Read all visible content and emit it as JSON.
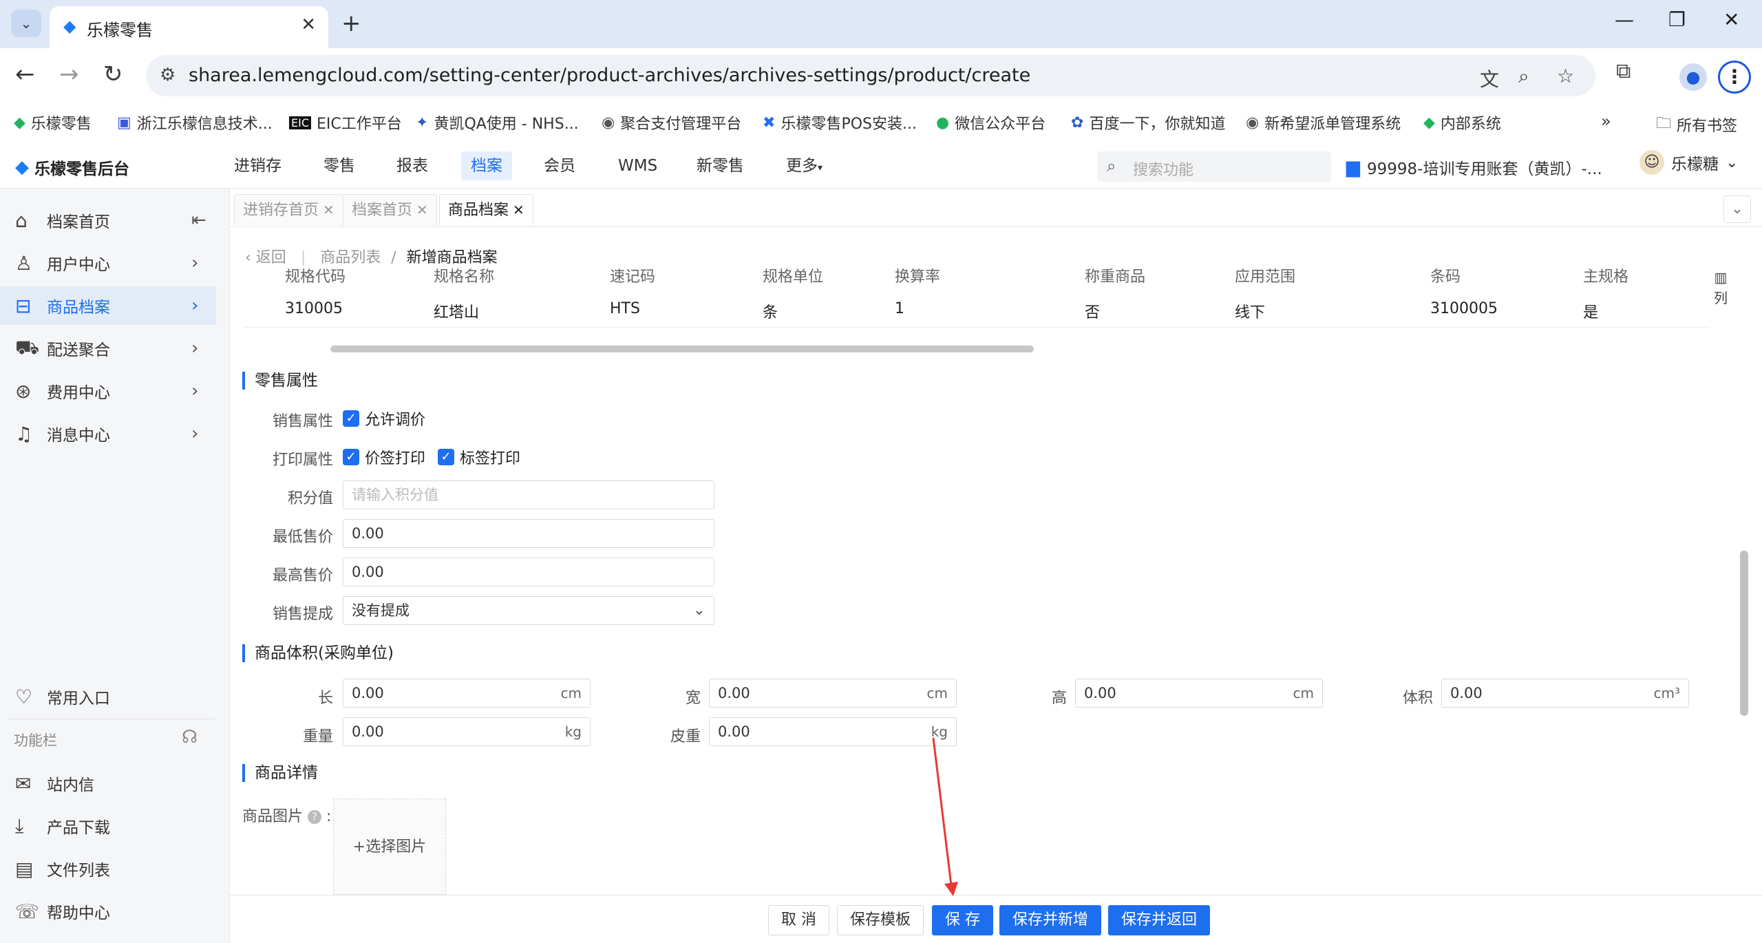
{
  "browser": {
    "tab_title": "乐檬零售",
    "url": "sharea.lemengcloud.com/setting-center/product-archives/archives-settings/product/create",
    "bookmarks": [
      "乐檬零售",
      "浙江乐檬信息技术...",
      "EIC工作平台",
      "黄凯QA使用 - NHS...",
      "聚合支付管理平台",
      "乐檬零售POS安装...",
      "微信公众平台",
      "百度一下，你就知道",
      "新希望派单管理系统",
      "内部系统"
    ],
    "all_bookmarks": "所有书签"
  },
  "header": {
    "logo": "乐檬零售后台",
    "nav": [
      "进销存",
      "零售",
      "报表",
      "档案",
      "会员",
      "WMS",
      "新零售",
      "更多"
    ],
    "search_placeholder": "搜索功能",
    "account": "99998-培训专用账套（黄凯）-...",
    "user": "乐檬糖"
  },
  "sidebar": {
    "items": [
      {
        "label": "档案首页"
      },
      {
        "label": "用户中心"
      },
      {
        "label": "商品档案"
      },
      {
        "label": "配送聚合"
      },
      {
        "label": "费用中心"
      },
      {
        "label": "消息中心"
      }
    ],
    "common_entry": "常用入口",
    "func_bar": "功能栏",
    "tools": [
      {
        "label": "站内信"
      },
      {
        "label": "产品下载"
      },
      {
        "label": "文件列表"
      },
      {
        "label": "帮助中心"
      }
    ]
  },
  "content_tabs": [
    "进销存首页",
    "档案首页",
    "商品档案"
  ],
  "breadcrumb": {
    "back": "返回",
    "list": "商品列表",
    "sep": "/",
    "current": "新增商品档案"
  },
  "spec_table": {
    "columns": [
      "规格代码",
      "规格名称",
      "速记码",
      "规格单位",
      "换算率",
      "称重商品",
      "应用范围",
      "条码",
      "主规格"
    ],
    "rows": [
      [
        "310005",
        "红塔山",
        "HTS",
        "条",
        "1",
        "否",
        "线下",
        "3100005",
        "是"
      ]
    ],
    "col_toggle": "列"
  },
  "retail": {
    "title": "零售属性",
    "sale_attr_label": "销售属性",
    "allow_price_adjust": "允许调价",
    "print_attr_label": "打印属性",
    "price_tag_print": "价签打印",
    "label_print": "标签打印",
    "points_label": "积分值",
    "points_placeholder": "请输入积分值",
    "min_price_label": "最低售价",
    "min_price": "0.00",
    "max_price_label": "最高售价",
    "max_price": "0.00",
    "commission_label": "销售提成",
    "commission": "没有提成"
  },
  "volume": {
    "title": "商品体积(采购单位)",
    "length_label": "长",
    "length": "0.00",
    "length_unit": "cm",
    "width_label": "宽",
    "width": "0.00",
    "width_unit": "cm",
    "height_label": "高",
    "height": "0.00",
    "height_unit": "cm",
    "volume_label": "体积",
    "volume": "0.00",
    "volume_unit": "cm³",
    "weight_label": "重量",
    "weight": "0.00",
    "weight_unit": "kg",
    "tare_label": "皮重",
    "tare": "0.00",
    "tare_unit": "kg"
  },
  "detail": {
    "title": "商品详情",
    "image_label": "商品图片",
    "image_colon": ":",
    "select_image": "+选择图片"
  },
  "footer": {
    "cancel": "取 消",
    "save_template": "保存模板",
    "save": "保 存",
    "save_and_new": "保存并新增",
    "save_and_return": "保存并返回"
  },
  "colors": {
    "primary": "#1e6ef0",
    "annotation": "#e53935"
  }
}
